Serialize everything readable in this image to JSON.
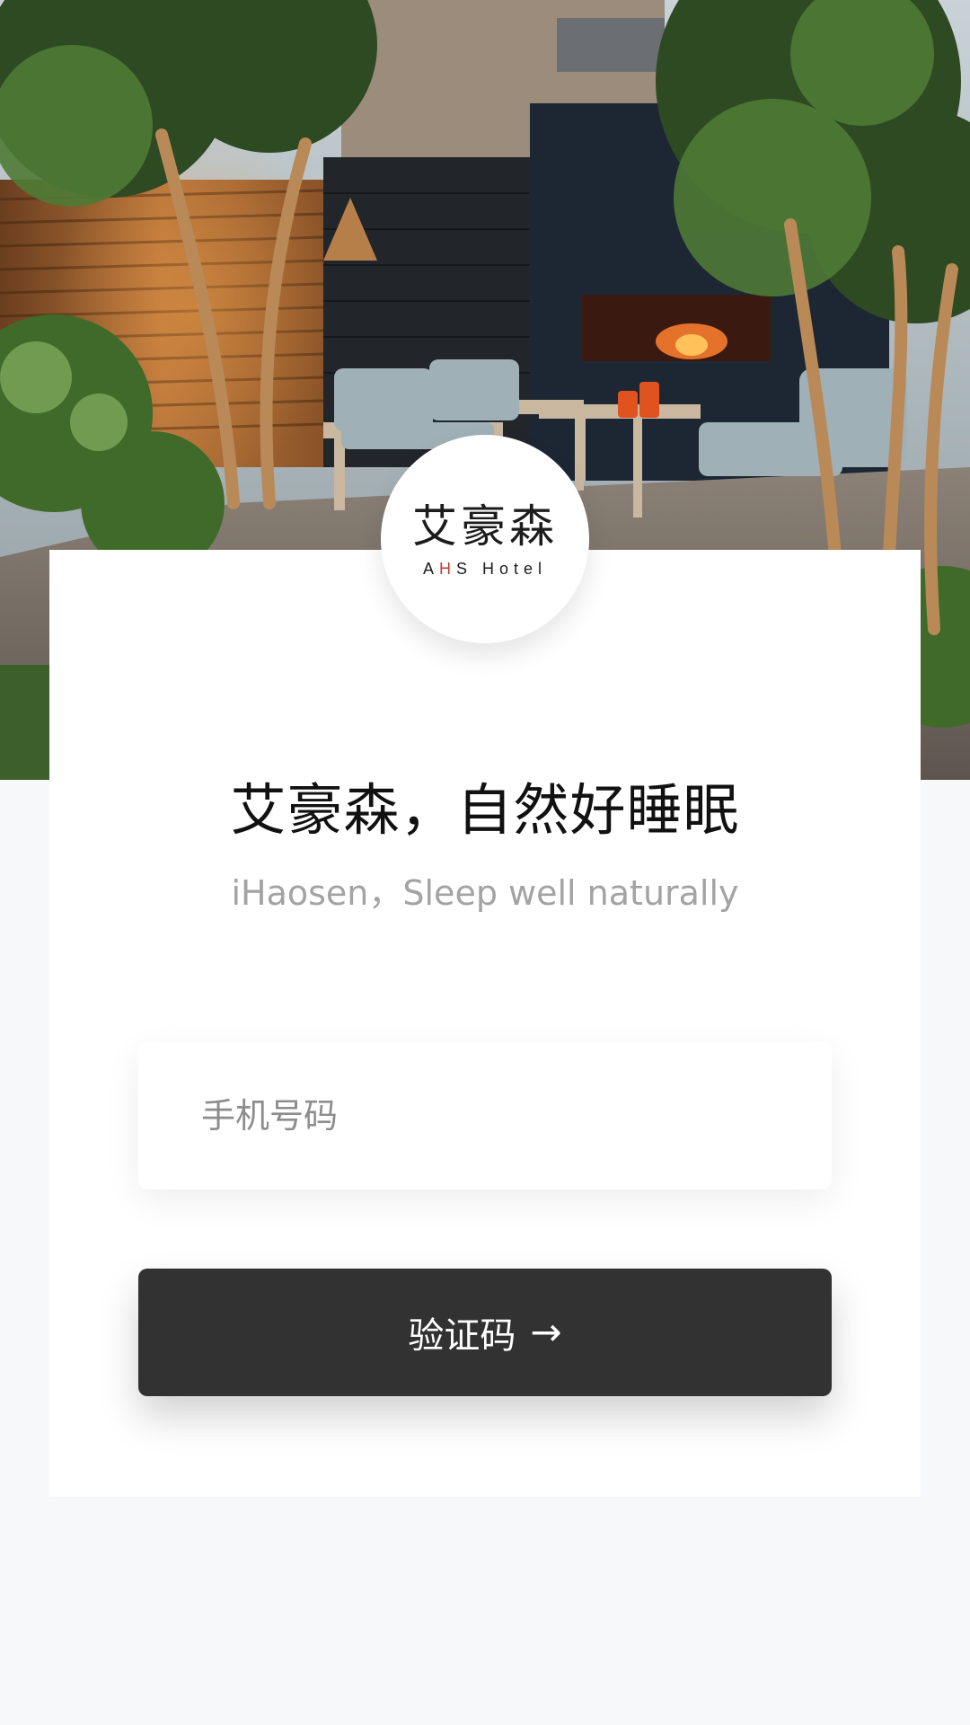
{
  "logo": {
    "cn": "艾豪森",
    "en_prefix": "A",
    "en_accent": "H",
    "en_suffix": "S Hotel"
  },
  "headline": "艾豪森，自然好睡眠",
  "subheadline": "iHaosen，Sleep well naturally",
  "phone_input": {
    "placeholder": "手机号码",
    "value": ""
  },
  "verify_button": {
    "label": "验证码",
    "icon": "arrow-right-icon",
    "arrow": "→"
  },
  "colors": {
    "page_bg": "#f7f8fa",
    "card_bg": "#ffffff",
    "button_bg": "#323232",
    "logo_accent": "#c0392b"
  }
}
